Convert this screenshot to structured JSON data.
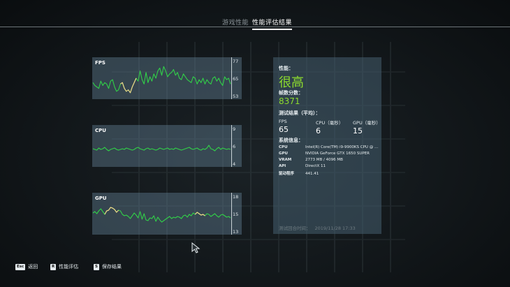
{
  "tabs": [
    {
      "label": "游戏性能",
      "active": false
    },
    {
      "label": "性能评估结果",
      "active": true
    }
  ],
  "graphs": [
    {
      "name": "FPS",
      "ticks": [
        "77",
        "65",
        "53"
      ],
      "ymin": 53,
      "ymax": 77,
      "values": [
        62,
        60,
        59,
        58,
        63,
        60,
        62,
        61,
        58,
        63,
        64,
        59,
        56,
        57,
        61,
        62,
        58,
        56,
        57,
        55,
        59,
        62,
        65,
        63,
        70,
        64,
        61,
        69,
        62,
        66,
        63,
        68,
        65,
        70,
        72,
        67,
        73,
        70,
        66,
        68,
        69,
        71,
        67,
        69,
        65,
        64,
        68,
        66,
        64,
        63,
        62,
        66,
        65,
        61,
        64,
        62,
        65,
        61,
        64,
        62,
        61,
        65,
        66,
        63,
        65,
        62,
        60,
        66,
        64,
        65,
        61
      ],
      "highlight": [
        [
          14,
          22
        ]
      ]
    },
    {
      "name": "CPU",
      "ticks": [
        "9",
        "6",
        "4"
      ],
      "ymin": 4,
      "ymax": 9,
      "values": [
        6.1,
        6.0,
        5.9,
        6.2,
        6.0,
        6.1,
        6.3,
        6.0,
        5.8,
        6.0,
        6.1,
        6.2,
        6.0,
        5.9,
        6.0,
        6.1,
        6.0,
        6.2,
        6.1,
        6.0,
        5.9,
        6.0,
        6.2,
        6.3,
        6.1,
        6.0,
        5.9,
        6.1,
        6.2,
        6.0,
        6.1,
        6.0,
        5.9,
        6.0,
        6.2,
        6.1,
        6.0,
        6.1,
        6.2,
        6.0,
        6.1,
        6.0,
        6.2,
        6.1,
        6.0,
        5.9,
        6.0,
        6.1,
        6.2,
        6.3,
        6.1,
        6.0,
        6.1,
        6.2,
        6.0,
        5.9,
        6.1,
        6.0,
        6.2,
        6.6,
        6.1,
        6.0,
        5.8,
        6.1,
        6.3,
        6.0,
        6.2,
        6.1,
        6.0,
        6.1,
        6.0
      ],
      "highlight": []
    },
    {
      "name": "GPU",
      "ticks": [
        "18",
        "15",
        "13"
      ],
      "ymin": 13,
      "ymax": 18,
      "values": [
        15.6,
        15.8,
        15.5,
        15.9,
        16.2,
        15.8,
        15.4,
        15.9,
        16.0,
        16.4,
        16.3,
        16.1,
        15.7,
        16.0,
        15.9,
        15.4,
        15.2,
        15.3,
        15.1,
        14.8,
        15.2,
        15.6,
        15.3,
        14.9,
        15.8,
        14.7,
        15.5,
        14.6,
        14.5,
        14.9,
        14.8,
        15.2,
        14.4,
        15.0,
        14.6,
        14.3,
        14.5,
        14.7,
        14.9,
        15.1,
        14.8,
        15.0,
        14.9,
        15.1,
        15.0,
        14.8,
        15.2,
        15.3,
        15.0,
        15.4,
        15.2,
        15.6,
        15.4,
        15.7,
        15.5,
        15.3,
        15.4,
        15.2,
        15.5,
        15.4,
        15.1,
        15.3,
        15.5,
        15.2,
        15.0,
        15.3,
        15.4,
        15.2,
        15.0,
        15.1,
        14.9
      ],
      "highlight": [
        [
          6,
          13
        ],
        [
          52,
          57
        ]
      ]
    }
  ],
  "colors": {
    "line": "#31d048",
    "highlight": "#f0d58a",
    "accent": "#8ddc2e"
  },
  "panel": {
    "performance_label": "性能：",
    "performance_value": "很高",
    "score_label": "帧数分数：",
    "score_value": "8371",
    "results_label": "测试结果（平均）：",
    "results": [
      {
        "label": "FPS",
        "value": "65"
      },
      {
        "label": "CPU（毫秒）",
        "value": "6"
      },
      {
        "label": "GPU（毫秒）",
        "value": "15"
      }
    ],
    "system_label": "系统信息：",
    "system": [
      {
        "key": "CPU",
        "value": "Intel(R) Core(TM) i9-9900KS CPU @ ..."
      },
      {
        "key": "GPU",
        "value": "NVIDIA GeForce GTX 1650 SUPER"
      },
      {
        "key": "VRAM",
        "value": "2773 MB / 4096 MB"
      },
      {
        "key": "API",
        "value": "DirectX 11"
      },
      {
        "key": "驱动程序",
        "value": "441.41"
      }
    ],
    "footer_label": "测试回合时间：",
    "footer_value": "2019/11/28 17:33"
  },
  "bottom": [
    {
      "key": "Esc",
      "label": "返回"
    },
    {
      "key": "R",
      "label": "性能评估"
    },
    {
      "key": "S",
      "label": "保存结果"
    }
  ]
}
